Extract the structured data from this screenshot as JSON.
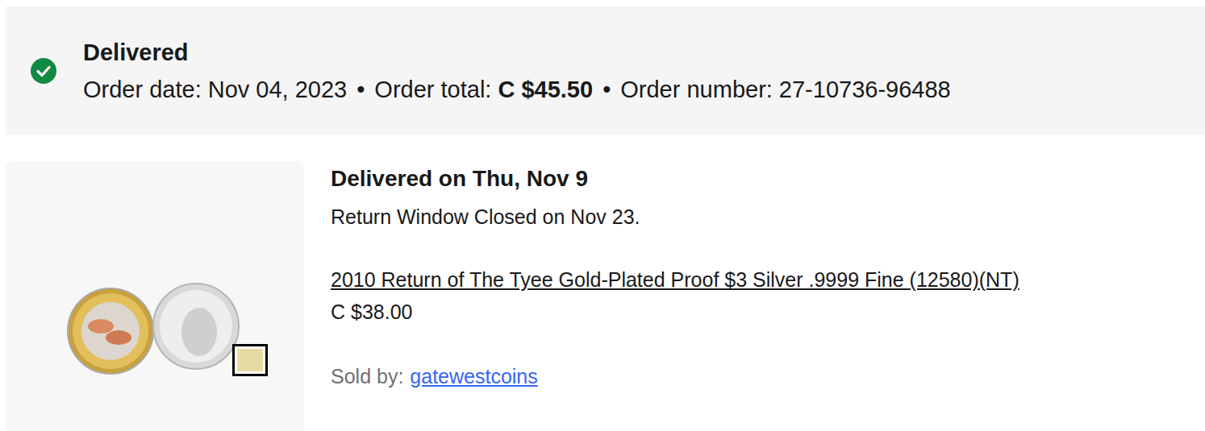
{
  "order": {
    "status": "Delivered",
    "date_label": "Order date:",
    "date": "Nov 04, 2023",
    "total_label": "Order total:",
    "total": "C $45.50",
    "number_label": "Order number:",
    "number": "27-10736-96488",
    "separator": "•"
  },
  "item": {
    "delivery": "Delivered on Thu, Nov 9",
    "return_window": "Return Window Closed on Nov 23.",
    "title": "2010 Return of The Tyee Gold-Plated Proof $3 Silver .9999 Fine (12580)(NT)",
    "price": "C $38.00",
    "sold_by_label": "Sold by:",
    "seller": "gatewestcoins"
  }
}
